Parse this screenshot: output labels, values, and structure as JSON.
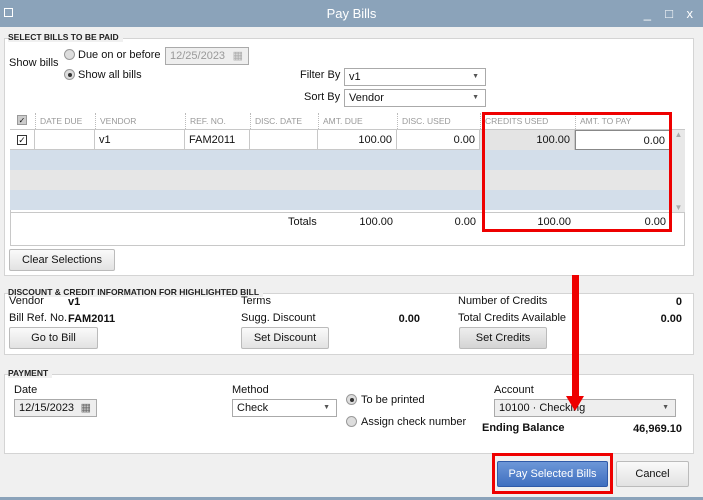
{
  "window": {
    "title": "Pay Bills",
    "minimize": "_",
    "maximize": "□",
    "close": "x"
  },
  "select": {
    "section": "SELECT BILLS TO BE PAID",
    "show_bills": "Show bills",
    "due_on_before": "Due on or before",
    "due_date": "12/25/2023",
    "show_all": "Show all bills",
    "filter_label": "Filter By",
    "filter_value": "v1",
    "sort_label": "Sort By",
    "sort_value": "Vendor"
  },
  "table": {
    "columns": [
      "DATE DUE",
      "VENDOR",
      "REF. NO.",
      "DISC. DATE",
      "AMT. DUE",
      "DISC. USED",
      "CREDITS USED",
      "AMT. TO PAY"
    ],
    "rows": [
      {
        "checked": true,
        "date_due": "",
        "vendor": "v1",
        "ref": "FAM2011",
        "disc_date": "",
        "amt_due": "100.00",
        "disc_used": "0.00",
        "credits_used": "100.00",
        "amt_to_pay": "0.00"
      }
    ],
    "totals": {
      "label": "Totals",
      "amt_due": "100.00",
      "disc_used": "0.00",
      "credits_used": "100.00",
      "amt_to_pay": "0.00"
    }
  },
  "clear_selections": "Clear Selections",
  "discount": {
    "section": "DISCOUNT & CREDIT INFORMATION FOR HIGHLIGHTED BILL",
    "vendor_label": "Vendor",
    "vendor": "v1",
    "billref_label": "Bill Ref. No.",
    "billref": "FAM2011",
    "terms_label": "Terms",
    "sugg_label": "Sugg. Discount",
    "sugg": "0.00",
    "numcred_label": "Number of Credits",
    "numcred": "0",
    "totcred_label": "Total Credits Available",
    "totcred": "0.00",
    "go_to_bill": "Go to Bill",
    "set_discount": "Set Discount",
    "set_credits": "Set Credits"
  },
  "payment": {
    "section": "PAYMENT",
    "date_label": "Date",
    "date": "12/15/2023",
    "method_label": "Method",
    "method": "Check",
    "to_be_printed": "To be printed",
    "assign": "Assign check number",
    "account_label": "Account",
    "account": "10100 · Checking",
    "ending_label": "Ending Balance",
    "ending": "46,969.10"
  },
  "pay_selected": "Pay Selected Bills",
  "cancel": "Cancel"
}
